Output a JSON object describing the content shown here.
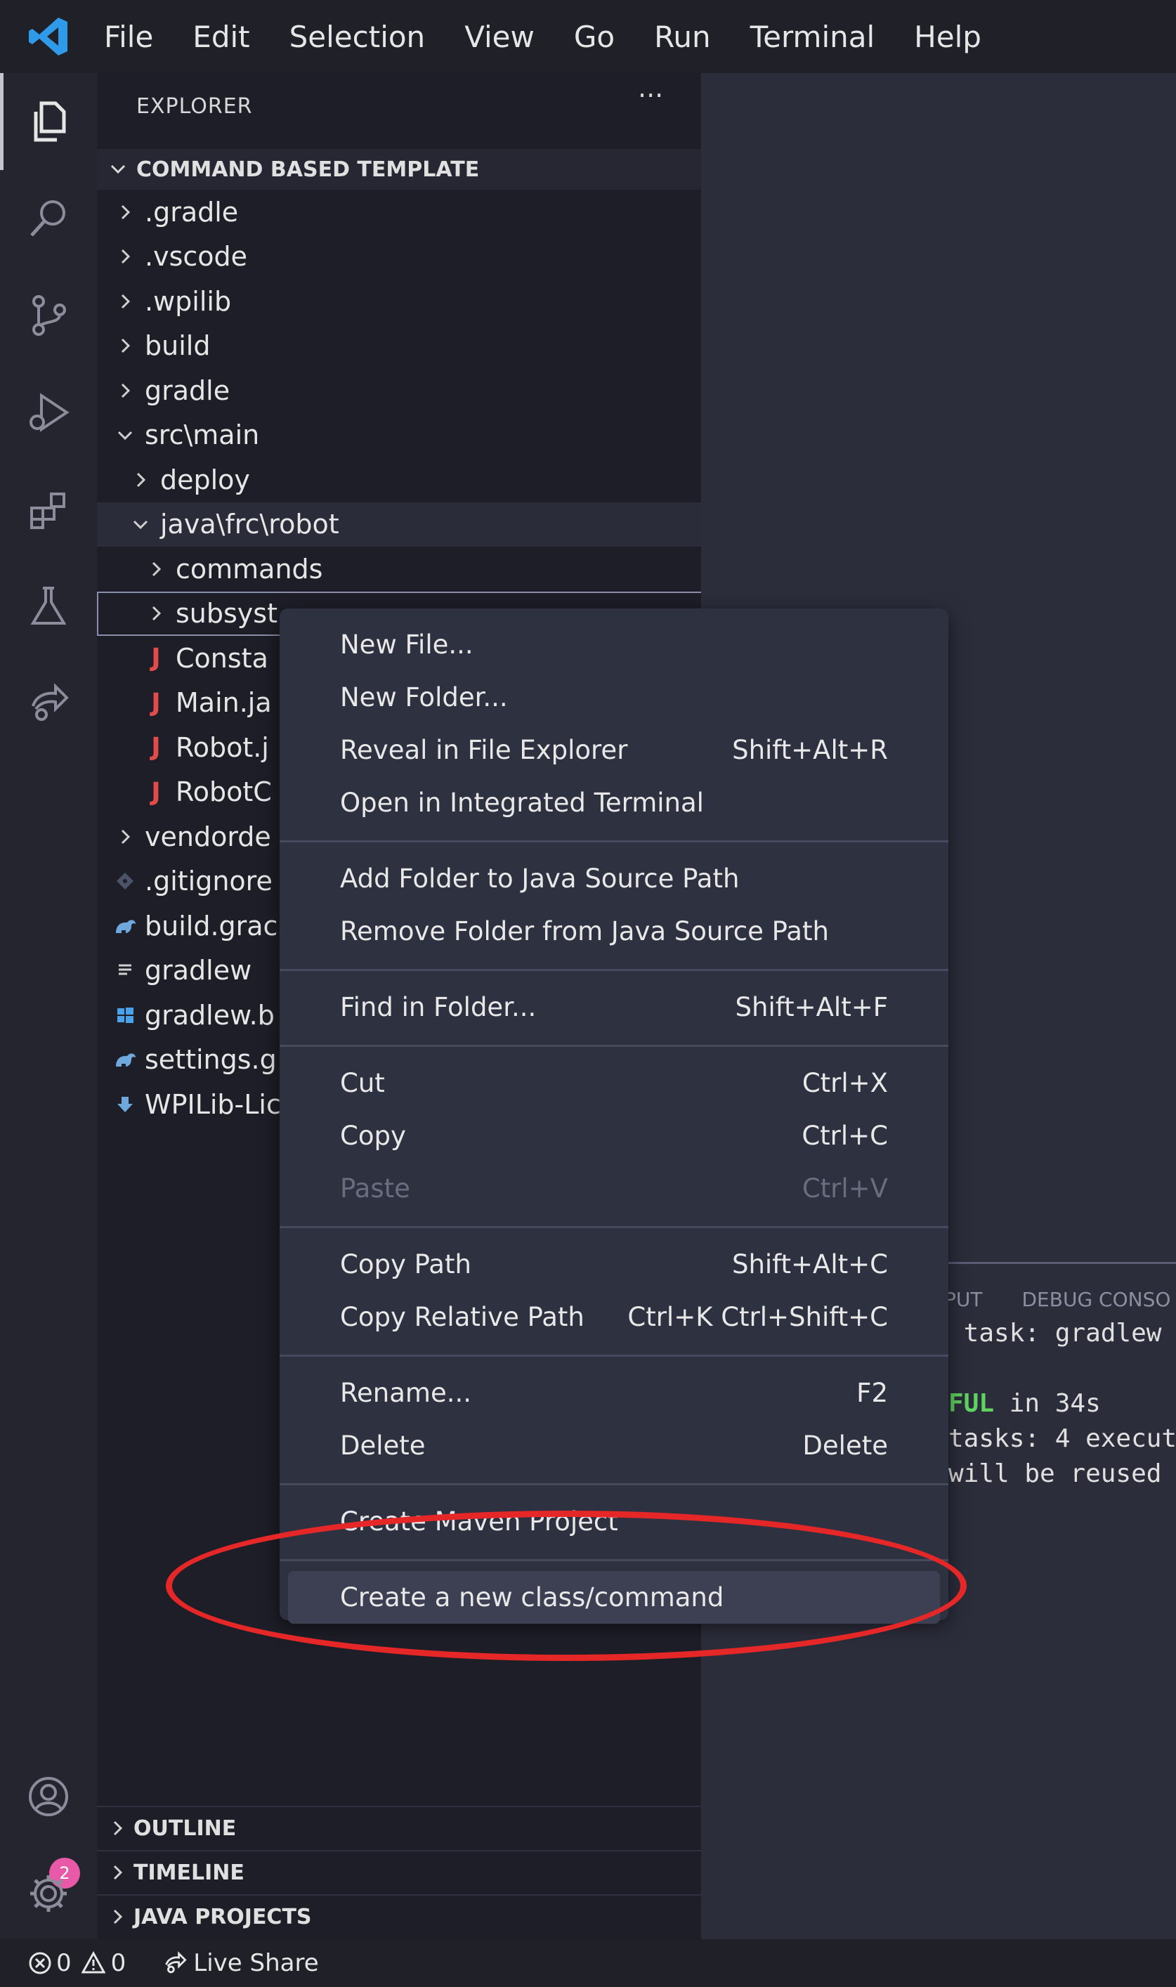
{
  "menubar": {
    "items": [
      "File",
      "Edit",
      "Selection",
      "View",
      "Go",
      "Run",
      "Terminal",
      "Help"
    ]
  },
  "activity_bar": {
    "items": [
      "explorer-icon",
      "search-icon",
      "source-control-icon",
      "run-debug-icon",
      "extensions-icon",
      "testing-icon",
      "live-share-icon"
    ],
    "accounts_badge": "2"
  },
  "explorer": {
    "title": "EXPLORER",
    "more": "···",
    "project": "COMMAND BASED TEMPLATE",
    "tree": [
      {
        "label": ".gradle",
        "kind": "folder",
        "expanded": false
      },
      {
        "label": ".vscode",
        "kind": "folder",
        "expanded": false
      },
      {
        "label": ".wpilib",
        "kind": "folder",
        "expanded": false
      },
      {
        "label": "build",
        "kind": "folder",
        "expanded": false
      },
      {
        "label": "gradle",
        "kind": "folder",
        "expanded": false
      },
      {
        "label": "src\\main",
        "kind": "folder",
        "expanded": true
      },
      {
        "label": "deploy",
        "kind": "folder",
        "expanded": false
      },
      {
        "label": "java\\frc\\robot",
        "kind": "folder",
        "expanded": true
      },
      {
        "label": "commands",
        "kind": "folder",
        "expanded": false
      },
      {
        "label": "subsyst",
        "kind": "folder",
        "expanded": false
      },
      {
        "label": "Consta",
        "kind": "java"
      },
      {
        "label": "Main.ja",
        "kind": "java"
      },
      {
        "label": "Robot.j",
        "kind": "java"
      },
      {
        "label": "RobotC",
        "kind": "java"
      },
      {
        "label": "vendorde",
        "kind": "folder",
        "expanded": false
      },
      {
        "label": ".gitignore",
        "kind": "git"
      },
      {
        "label": "build.grac",
        "kind": "gradle"
      },
      {
        "label": "gradlew",
        "kind": "text"
      },
      {
        "label": "gradlew.b",
        "kind": "windows"
      },
      {
        "label": "settings.g",
        "kind": "gradle"
      },
      {
        "label": "WPILib-Lic",
        "kind": "license"
      }
    ],
    "sections": [
      "OUTLINE",
      "TIMELINE",
      "JAVA PROJECTS"
    ]
  },
  "panel": {
    "tabs": [
      "PUT",
      "DEBUG CONSO"
    ],
    "lines": [
      {
        "text": " task: gradlew",
        "ok": ""
      },
      {
        "text": "",
        "ok": ""
      },
      {
        "text": " in 34s",
        "ok": "FUL"
      },
      {
        "text": "tasks: 4 execut",
        "ok": ""
      },
      {
        "text": "will be reused",
        "ok": ""
      }
    ]
  },
  "context_menu": {
    "items": [
      {
        "label": "New File...",
        "shortcut": "",
        "disabled": false
      },
      {
        "label": "New Folder...",
        "shortcut": "",
        "disabled": false
      },
      {
        "label": "Reveal in File Explorer",
        "shortcut": "Shift+Alt+R",
        "disabled": false
      },
      {
        "label": "Open in Integrated Terminal",
        "shortcut": "",
        "disabled": false
      },
      {
        "separator": true
      },
      {
        "label": "Add Folder to Java Source Path",
        "shortcut": "",
        "disabled": false
      },
      {
        "label": "Remove Folder from Java Source Path",
        "shortcut": "",
        "disabled": false
      },
      {
        "separator": true
      },
      {
        "label": "Find in Folder...",
        "shortcut": "Shift+Alt+F",
        "disabled": false
      },
      {
        "separator": true
      },
      {
        "label": "Cut",
        "shortcut": "Ctrl+X",
        "disabled": false
      },
      {
        "label": "Copy",
        "shortcut": "Ctrl+C",
        "disabled": false
      },
      {
        "label": "Paste",
        "shortcut": "Ctrl+V",
        "disabled": true
      },
      {
        "separator": true
      },
      {
        "label": "Copy Path",
        "shortcut": "Shift+Alt+C",
        "disabled": false
      },
      {
        "label": "Copy Relative Path",
        "shortcut": "Ctrl+K Ctrl+Shift+C",
        "disabled": false
      },
      {
        "separator": true
      },
      {
        "label": "Rename...",
        "shortcut": "F2",
        "disabled": false
      },
      {
        "label": "Delete",
        "shortcut": "Delete",
        "disabled": false
      },
      {
        "separator": true
      },
      {
        "label": "Create Maven Project",
        "shortcut": "",
        "disabled": false
      },
      {
        "separator": true
      },
      {
        "label": "Create a new class/command",
        "shortcut": "",
        "disabled": false,
        "highlighted": true
      }
    ]
  },
  "status_bar": {
    "errors": "0",
    "warnings": "0",
    "live_share": "Live Share"
  },
  "colors": {
    "annotation_red": "#e52727",
    "java_icon": "#e34c4c",
    "accounts_badge": "#e85aa8",
    "terminal_success": "#5fd35f"
  }
}
